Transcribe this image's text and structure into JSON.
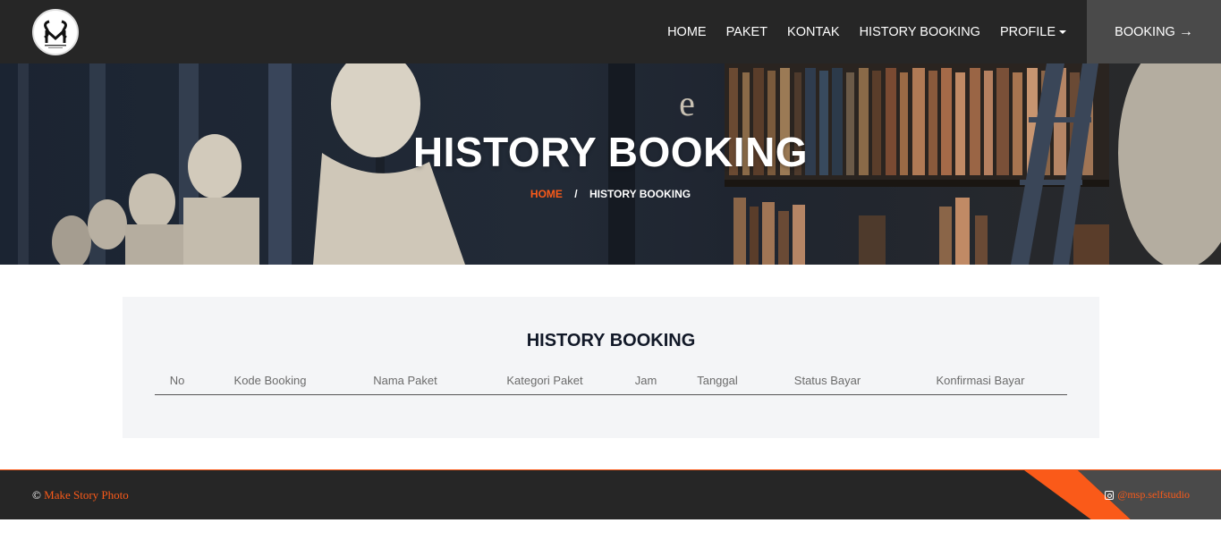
{
  "nav": {
    "items": [
      {
        "label": "HOME"
      },
      {
        "label": "PAKET"
      },
      {
        "label": "KONTAK"
      },
      {
        "label": "HISTORY BOOKING"
      },
      {
        "label": "PROFILE"
      }
    ],
    "booking_label": "BOOKING",
    "booking_arrow": "→"
  },
  "hero": {
    "title": "HISTORY BOOKING",
    "breadcrumb": {
      "home": "HOME",
      "separator": "/",
      "current": "HISTORY BOOKING"
    }
  },
  "table": {
    "title": "HISTORY BOOKING",
    "columns": [
      "No",
      "Kode Booking",
      "Nama Paket",
      "Kategori Paket",
      "Jam",
      "Tanggal",
      "Status Bayar",
      "Konfirmasi Bayar"
    ],
    "rows": []
  },
  "footer": {
    "copyright_symbol": "©",
    "brand": "Make Story Photo",
    "instagram": "@msp.selfstudio"
  },
  "colors": {
    "accent": "#fa5a19",
    "navbar": "#262626",
    "booking_button": "#4a4a4a",
    "panel": "#f4f5f7"
  }
}
